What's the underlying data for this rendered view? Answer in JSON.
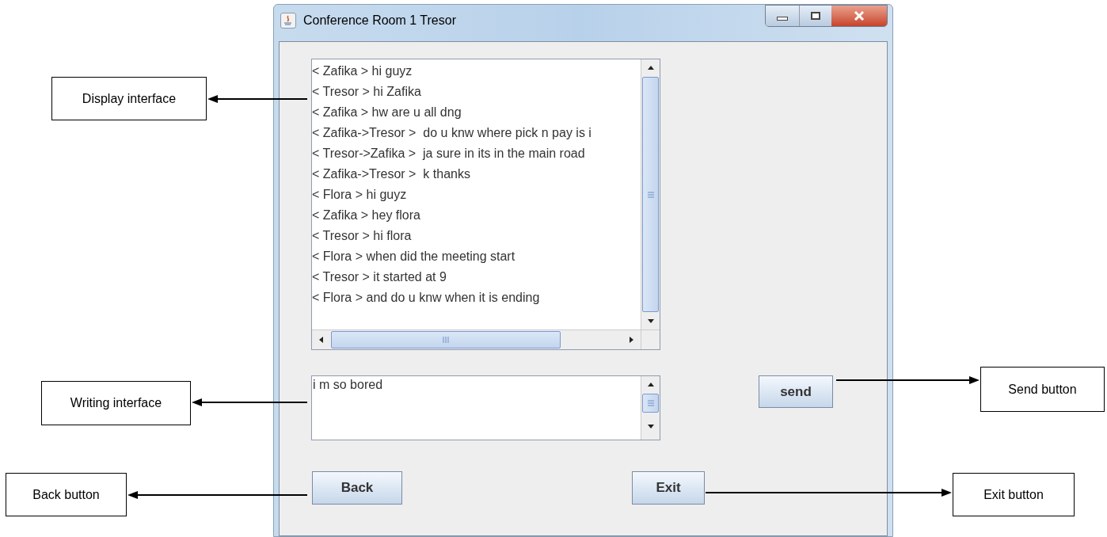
{
  "window": {
    "title": "Conference Room 1 Tresor"
  },
  "chat_log": {
    "messages": [
      "< Zafika > hi guyz",
      "< Tresor > hi Zafika",
      "< Zafika > hw are u all dng",
      "< Zafika->Tresor >  do u knw where pick n pay is i",
      "< Tresor->Zafika >  ja sure in its in the main road",
      "< Zafika->Tresor >  k thanks",
      "< Flora > hi guyz",
      "< Zafika > hey flora",
      "< Tresor > hi flora",
      "< Flora > when did the meeting start",
      "< Tresor > it started at 9",
      "< Flora > and do u knw when it is ending"
    ]
  },
  "message_input": {
    "value": "i m so bored"
  },
  "buttons": {
    "send": "send",
    "back": "Back",
    "exit": "Exit"
  },
  "annotations": [
    {
      "label": "Display interface",
      "kind": "display"
    },
    {
      "label": "Writing interface",
      "kind": "writing"
    },
    {
      "label": "Back button",
      "kind": "back"
    },
    {
      "label": "Send button",
      "kind": "send"
    },
    {
      "label": "Exit button",
      "kind": "exit"
    }
  ]
}
